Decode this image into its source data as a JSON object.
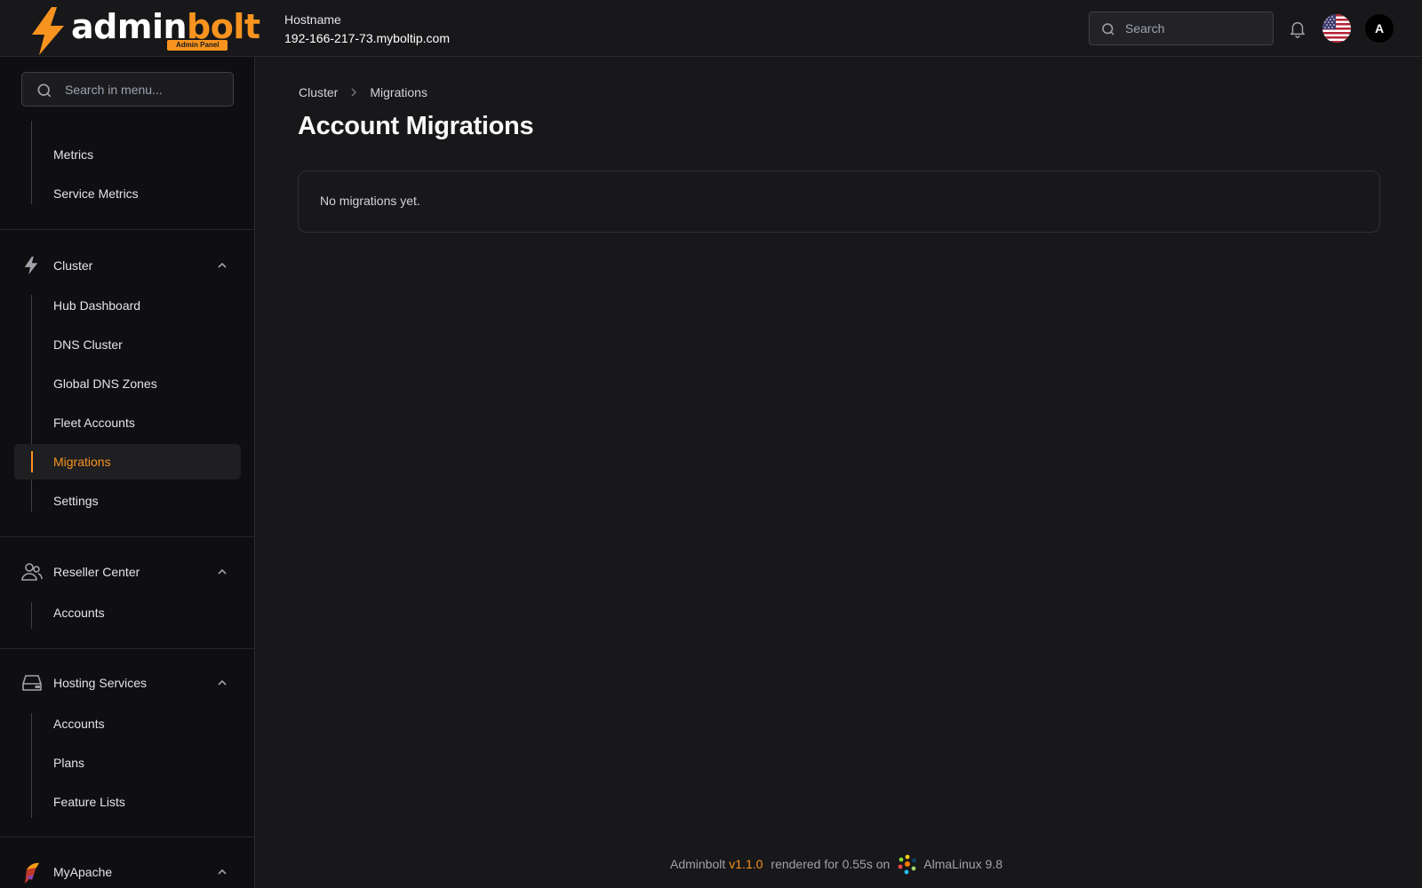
{
  "brand": {
    "name_part1": "admin",
    "name_part2": "bolt",
    "tagline": "Admin Panel",
    "accent_color": "#f7931e"
  },
  "header": {
    "hostname_label": "Hostname",
    "hostname_value": "192-166-217-73.myboltip.com",
    "search_placeholder": "Search",
    "avatar_letter": "A",
    "language_flag": "us-flag-icon"
  },
  "sidebar": {
    "search_placeholder": "Search in menu...",
    "groups": [
      {
        "label": "",
        "items": [
          "Metrics",
          "Service Metrics"
        ]
      },
      {
        "label": "Cluster",
        "icon": "lightning-icon",
        "items": [
          "Hub Dashboard",
          "DNS Cluster",
          "Global DNS Zones",
          "Fleet Accounts",
          "Migrations",
          "Settings"
        ],
        "active_item": "Migrations"
      },
      {
        "label": "Reseller Center",
        "icon": "users-icon",
        "items": [
          "Accounts"
        ]
      },
      {
        "label": "Hosting Services",
        "icon": "hard-drive-icon",
        "items": [
          "Accounts",
          "Plans",
          "Feature Lists"
        ]
      },
      {
        "label": "MyApache",
        "icon": "apache-feather-icon",
        "items": []
      }
    ]
  },
  "main": {
    "breadcrumb": [
      "Cluster",
      "Migrations"
    ],
    "title": "Account Migrations",
    "empty_message": "No migrations yet."
  },
  "footer": {
    "app": "Adminbolt",
    "version": "v1.1.0",
    "rendered_text": "rendered for 0.55s on",
    "os": "AlmaLinux 9.8"
  }
}
